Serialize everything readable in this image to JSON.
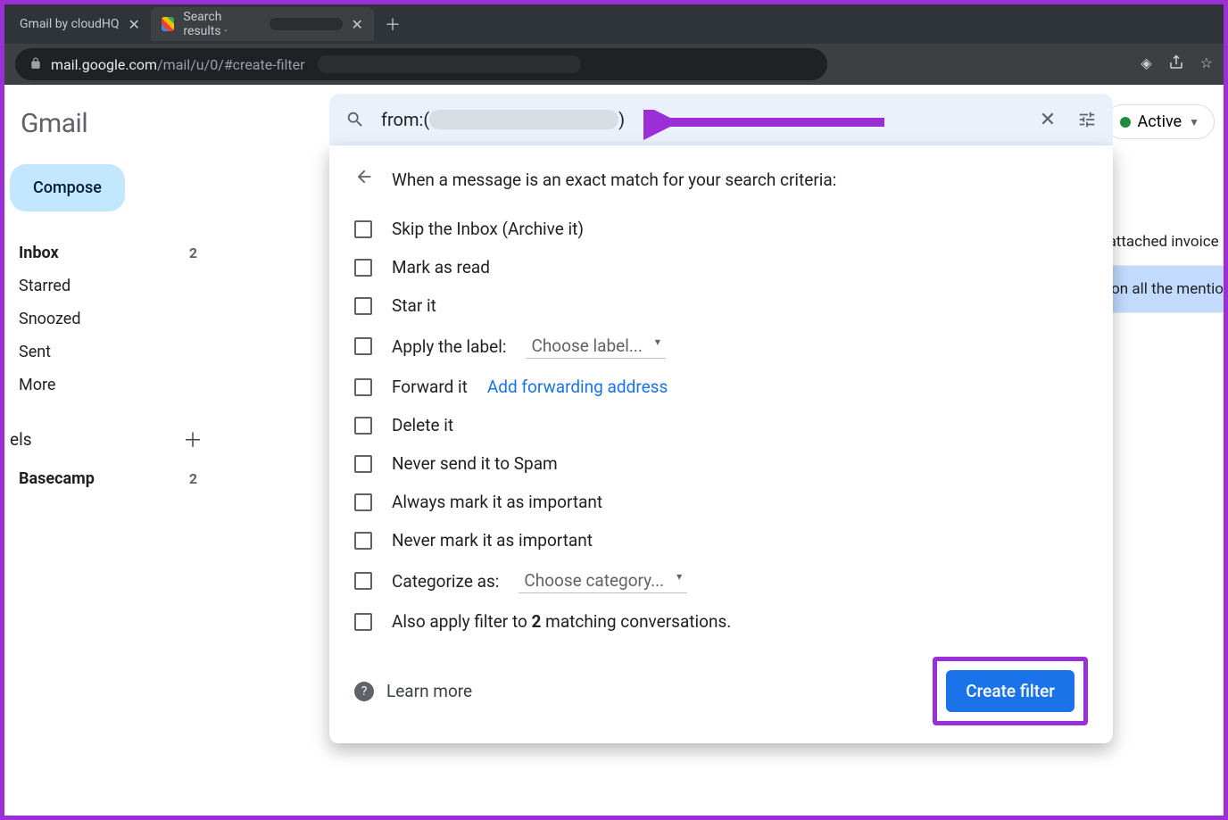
{
  "browser": {
    "tabs": [
      {
        "title": "Gmail by cloudHQ"
      },
      {
        "title": "Search results ·"
      }
    ],
    "url": {
      "host": "mail.google.com",
      "path": "/mail/u/0/#create-filter"
    }
  },
  "app_logo": "Gmail",
  "compose": "Compose",
  "nav": [
    {
      "label": "Inbox",
      "count": "2",
      "bold": true
    },
    {
      "label": "Starred"
    },
    {
      "label": "Snoozed"
    },
    {
      "label": "Sent"
    },
    {
      "label": "More"
    }
  ],
  "labels_header": "els",
  "labels": [
    {
      "label": "Basecamp",
      "count": "2",
      "bold": true
    }
  ],
  "search": {
    "prefix": "from:(",
    "suffix": ")"
  },
  "status": {
    "active": "Active",
    "hq_count": "1",
    "hq_text": "HQ",
    "hq_pre": "clou"
  },
  "filter": {
    "heading": "When a message is an exact match for your search criteria:",
    "options": {
      "skip_inbox": "Skip the Inbox (Archive it)",
      "mark_read": "Mark as read",
      "star": "Star it",
      "apply_label": "Apply the label:",
      "choose_label": "Choose label...",
      "forward": "Forward it",
      "forward_link": "Add forwarding address",
      "delete": "Delete it",
      "never_spam": "Never send it to Spam",
      "always_important": "Always mark it as important",
      "never_important": "Never mark it as important",
      "categorize": "Categorize as:",
      "choose_category": "Choose category...",
      "also_apply_pre": "Also apply filter to ",
      "also_apply_count": "2",
      "also_apply_post": " matching conversations."
    },
    "learn_more": "Learn more",
    "create": "Create filter"
  },
  "bg_rows": [
    "e find the attached invoice",
    "y account on all the mentio"
  ]
}
